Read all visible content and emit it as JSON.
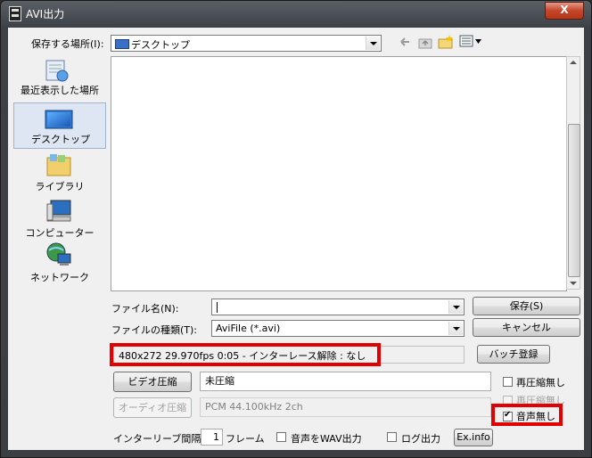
{
  "window": {
    "title": "AVI出力",
    "close_label": "X"
  },
  "location": {
    "label": "保存する場所(I):",
    "value": "デスクトップ"
  },
  "places": [
    {
      "label": "最近表示した場所",
      "icon": "recent-places-icon"
    },
    {
      "label": "デスクトップ",
      "icon": "desktop-icon"
    },
    {
      "label": "ライブラリ",
      "icon": "libraries-icon"
    },
    {
      "label": "コンピューター",
      "icon": "computer-icon"
    },
    {
      "label": "ネットワーク",
      "icon": "network-icon"
    }
  ],
  "filename": {
    "label": "ファイル名(N):",
    "value": ""
  },
  "filetype": {
    "label": "ファイルの種類(T):",
    "value": "AviFile (*.avi)"
  },
  "buttons": {
    "save": "保存(S)",
    "cancel": "キャンセル",
    "batch": "バッチ登録",
    "video_compress": "ビデオ圧縮",
    "audio_compress": "オーディオ圧縮",
    "exinfo": "Ex.info"
  },
  "info_text": "480x272  29.970fps  0:05  -  インターレース解除 : なし",
  "video_codec": "未圧縮",
  "audio_codec": "PCM 44.100kHz 2ch",
  "checks": {
    "recompress_none": "再圧縮無し",
    "recompress_none2": "再圧縮無し",
    "no_audio": "音声無し",
    "wav_out": "音声をWAV出力",
    "log_out": "ログ出力"
  },
  "interleave": {
    "label": "インターリーブ間隔 :",
    "value": "1",
    "unit": "フレーム"
  },
  "colors": {
    "highlight": "#e30000"
  }
}
